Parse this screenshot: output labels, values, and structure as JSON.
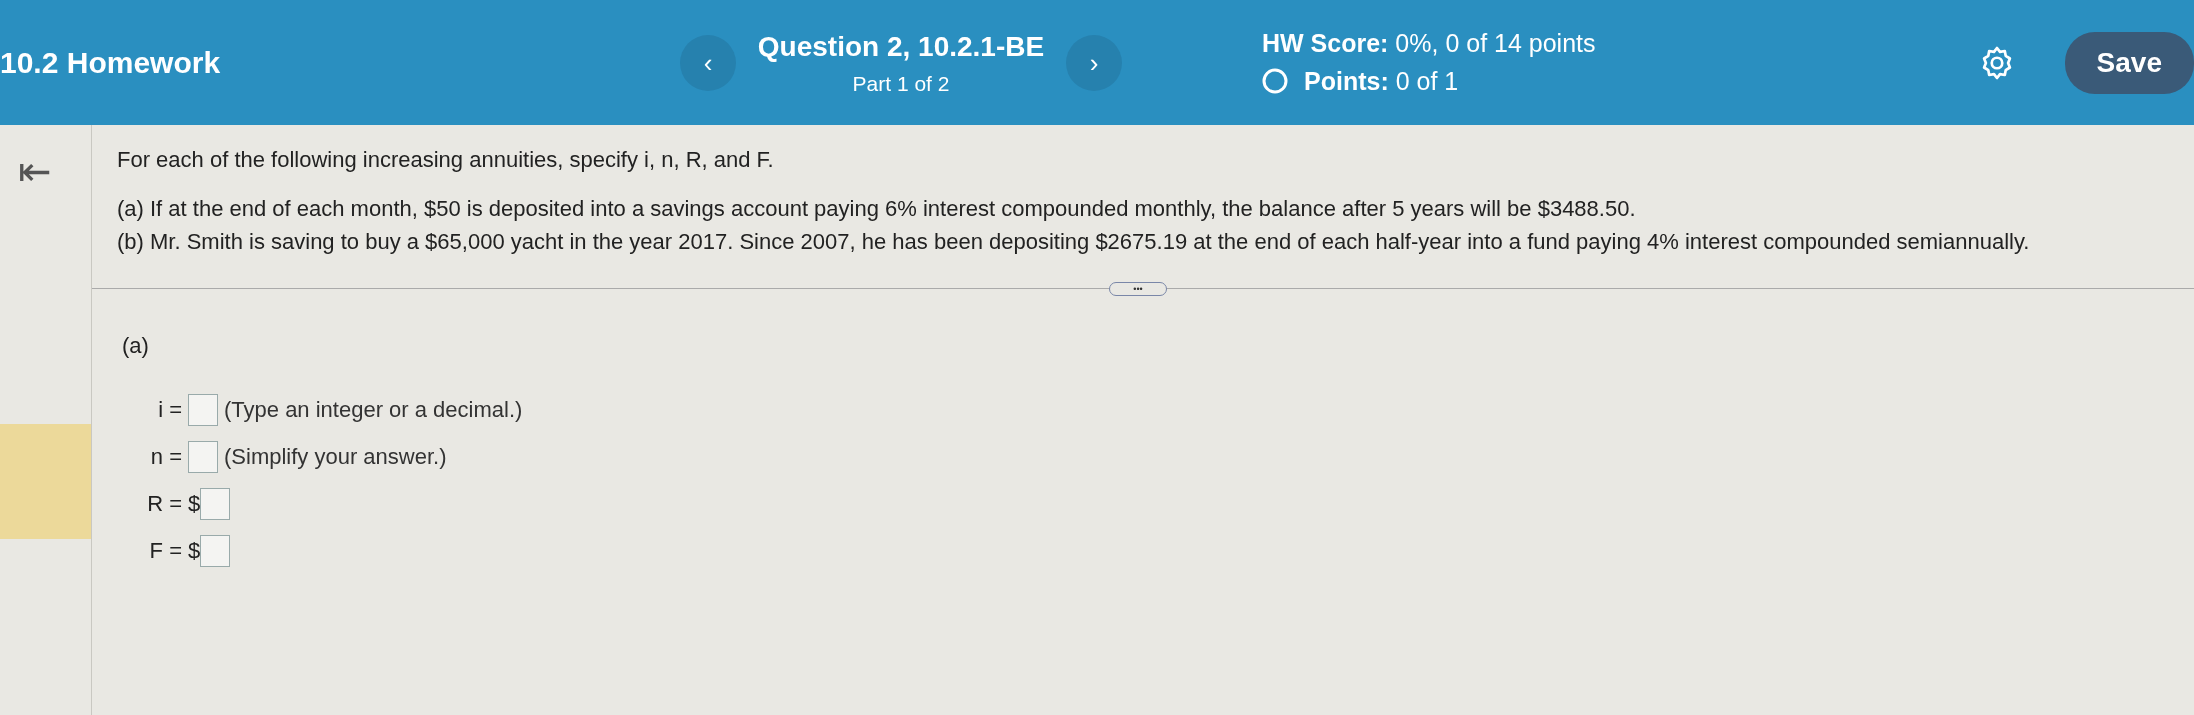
{
  "header": {
    "title": "10.2 Homework",
    "question": "Question 2, 10.2.1-BE",
    "part": "Part 1 of 2",
    "prev": "‹",
    "next": "›",
    "hw_score_label": "HW Score:",
    "hw_score": "0%, 0 of 14 points",
    "points_label": "Points:",
    "points": "0 of 1",
    "save": "Save"
  },
  "sidebar": {
    "collapse": "⇤"
  },
  "problem": {
    "intro": "For each of the following increasing annuities, specify i, n, R, and F.",
    "parts": [
      "(a) If at the end of each month, $50 is deposited into a savings account paying 6% interest compounded monthly, the balance after 5 years will be $3488.50.",
      "(b) Mr. Smith is saving to buy a $65,000 yacht in the year 2017. Since 2007, he has been depositing $2675.19 at the end of each half-year into a fund paying 4% interest compounded semiannually."
    ]
  },
  "divider": {
    "handle": "•••"
  },
  "answer": {
    "part_label": "(a)",
    "rows": [
      {
        "label": "i =",
        "hint": "(Type an integer or a decimal.)"
      },
      {
        "label": "n =",
        "hint": "(Simplify your answer.)"
      },
      {
        "label": "R =",
        "prefix": "$"
      },
      {
        "label": "F =",
        "prefix": "$"
      }
    ]
  }
}
